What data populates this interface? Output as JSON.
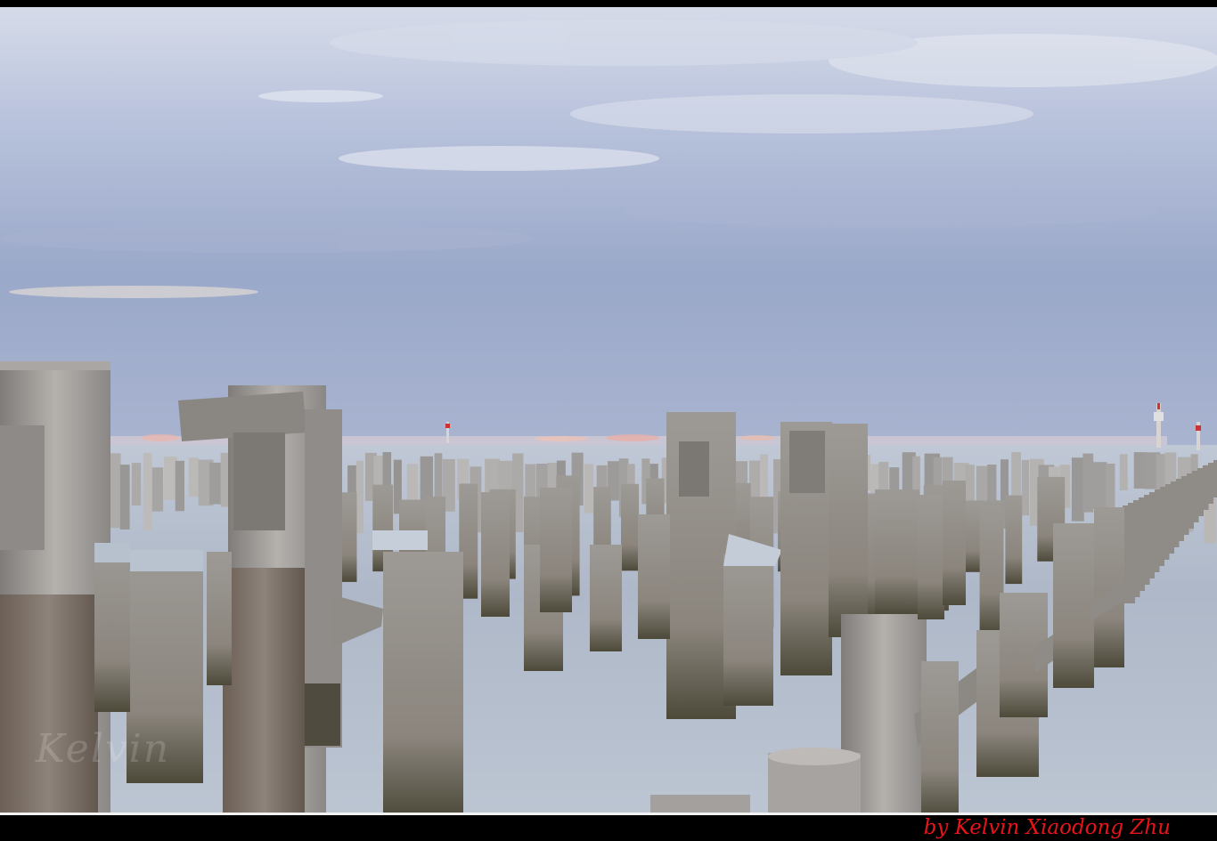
{
  "photo": {
    "subject": "weathered timber pier pilings in still sea under overcast sky"
  },
  "footer": {
    "credit": "by Kelvin Xiaodong Zhu"
  },
  "watermark": {
    "text": "Kelvin"
  },
  "colors": {
    "credit": "#e8141a",
    "sky_top": "#c7cfe3",
    "sky_mid": "#9eabcb",
    "water": "#b3bccd",
    "wood": "#9d9a97"
  }
}
